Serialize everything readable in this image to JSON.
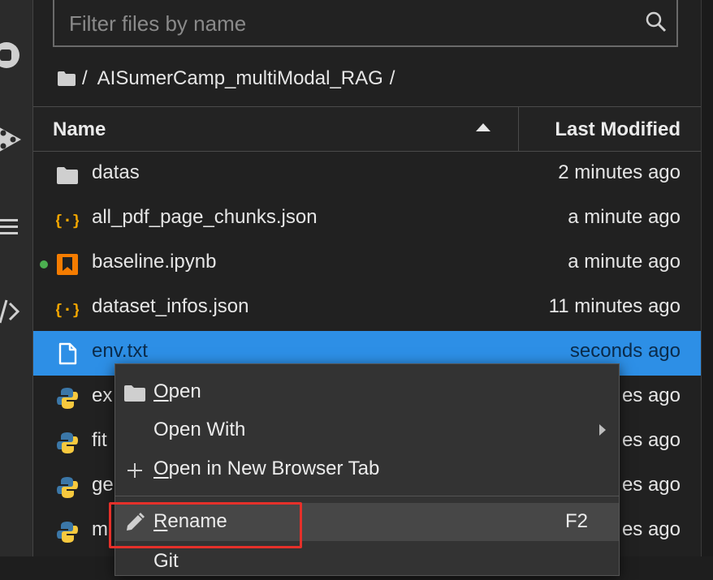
{
  "filter": {
    "placeholder": "Filter files by name"
  },
  "breadcrumb": {
    "root": "/",
    "folder": "AISumerCamp_multiModal_RAG",
    "trail": "/"
  },
  "columns": {
    "name": "Name",
    "modified": "Last Modified"
  },
  "files": [
    {
      "name": "datas",
      "modified": "2 minutes ago",
      "icon": "folder-icon"
    },
    {
      "name": "all_pdf_page_chunks.json",
      "modified": "a minute ago",
      "icon": "json-icon"
    },
    {
      "name": "baseline.ipynb",
      "modified": "a minute ago",
      "icon": "notebook-icon",
      "running": true
    },
    {
      "name": "dataset_infos.json",
      "modified": "11 minutes ago",
      "icon": "json-icon"
    },
    {
      "name": "env.txt",
      "modified": "seconds ago",
      "icon": "text-file-icon",
      "selected": true
    },
    {
      "name": "ex",
      "modified": "es ago",
      "icon": "python-icon"
    },
    {
      "name": "fit",
      "modified": "es ago",
      "icon": "python-icon"
    },
    {
      "name": "ge",
      "modified": "es ago",
      "icon": "python-icon"
    },
    {
      "name": "m",
      "modified": "es ago",
      "icon": "python-icon"
    }
  ],
  "context_menu": {
    "open": {
      "first": "O",
      "rest": "pen"
    },
    "open_with": "Open With",
    "open_new_tab": {
      "first": "O",
      "rest": "pen in New Browser Tab"
    },
    "rename": {
      "first": "R",
      "rest": "ename",
      "shortcut": "F2"
    },
    "next_partial": "Git"
  },
  "colors": {
    "selection": "#2d8fe6",
    "highlight": "#e5302a",
    "json": "#f0a500",
    "notebook": "#f57c00"
  }
}
